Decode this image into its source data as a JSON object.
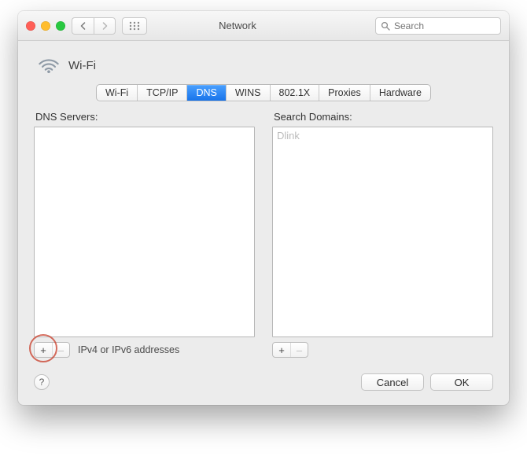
{
  "window": {
    "title": "Network"
  },
  "search": {
    "placeholder": "Search"
  },
  "header": {
    "connection_label": "Wi-Fi",
    "icon": "wifi-icon"
  },
  "tabs": [
    {
      "label": "Wi-Fi",
      "active": false
    },
    {
      "label": "TCP/IP",
      "active": false
    },
    {
      "label": "DNS",
      "active": true
    },
    {
      "label": "WINS",
      "active": false
    },
    {
      "label": "802.1X",
      "active": false
    },
    {
      "label": "Proxies",
      "active": false
    },
    {
      "label": "Hardware",
      "active": false
    }
  ],
  "dns": {
    "label": "DNS Servers:",
    "items": [],
    "hint": "IPv4 or IPv6 addresses",
    "add_label": "+",
    "remove_label": "–"
  },
  "search_domains": {
    "label": "Search Domains:",
    "items": [
      "Dlink"
    ],
    "add_label": "+",
    "remove_label": "–"
  },
  "buttons": {
    "help": "?",
    "cancel": "Cancel",
    "ok": "OK"
  }
}
